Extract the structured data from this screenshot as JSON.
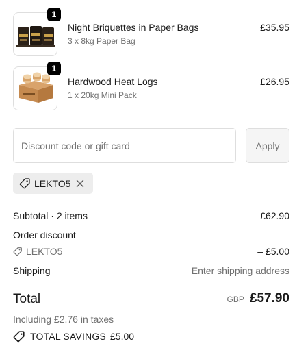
{
  "cart": {
    "items": [
      {
        "quantity": "1",
        "title": "Night Briquettes in Paper Bags",
        "variant": "3 x 8kg Paper Bag",
        "price": "£35.95",
        "image": "briquette-bags-image"
      },
      {
        "quantity": "1",
        "title": "Hardwood Heat Logs",
        "variant": "1 x 20kg Mini Pack",
        "price": "£26.95",
        "image": "heat-logs-box-image"
      }
    ]
  },
  "discount": {
    "placeholder": "Discount code or gift card",
    "apply_label": "Apply",
    "applied_code": "LEKTO5"
  },
  "summary": {
    "subtotal_label": "Subtotal · 2 items",
    "subtotal_value": "£62.90",
    "order_discount_label": "Order discount",
    "discount_code": "LEKTO5",
    "discount_value": "– £5.00",
    "shipping_label": "Shipping",
    "shipping_value": "Enter shipping address",
    "total_label": "Total",
    "currency": "GBP",
    "total_value": "£57.90",
    "taxes_text": "Including £2.76 in taxes",
    "savings_label": "TOTAL SAVINGS",
    "savings_value": "£5.00"
  },
  "icons": [
    "tag-icon",
    "close-icon"
  ]
}
